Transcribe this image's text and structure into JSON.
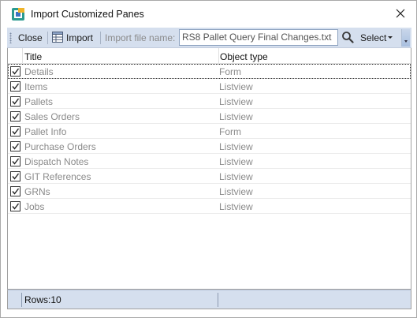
{
  "window": {
    "title": "Import Customized Panes",
    "app_icon": "app-logo-icon",
    "close_icon": "close-icon"
  },
  "toolbar": {
    "close_label": "Close",
    "import_label": "Import",
    "import_icon": "table-icon",
    "file_name_label": "Import file name:",
    "file_name_value": "RS8 Pallet Query Final Changes.txt",
    "search_icon": "search-icon",
    "select_label": "Select"
  },
  "grid": {
    "columns": [
      "Title",
      "Object type"
    ],
    "rows": [
      {
        "title": "Details",
        "type": "Form",
        "checked": true,
        "selected": true
      },
      {
        "title": "Items",
        "type": "Listview",
        "checked": true
      },
      {
        "title": "Pallets",
        "type": "Listview",
        "checked": true
      },
      {
        "title": "Sales Orders",
        "type": "Listview",
        "checked": true
      },
      {
        "title": "Pallet Info",
        "type": "Form",
        "checked": true
      },
      {
        "title": "Purchase Orders",
        "type": "Listview",
        "checked": true
      },
      {
        "title": "Dispatch Notes",
        "type": "Listview",
        "checked": true
      },
      {
        "title": "GIT References",
        "type": "Listview",
        "checked": true
      },
      {
        "title": "GRNs",
        "type": "Listview",
        "checked": true
      },
      {
        "title": "Jobs",
        "type": "Listview",
        "checked": true
      }
    ]
  },
  "status": {
    "rows_text": "Rows:10"
  },
  "colors": {
    "toolbar_bg": "#d5dfee",
    "muted_text": "#8a8a8a"
  }
}
